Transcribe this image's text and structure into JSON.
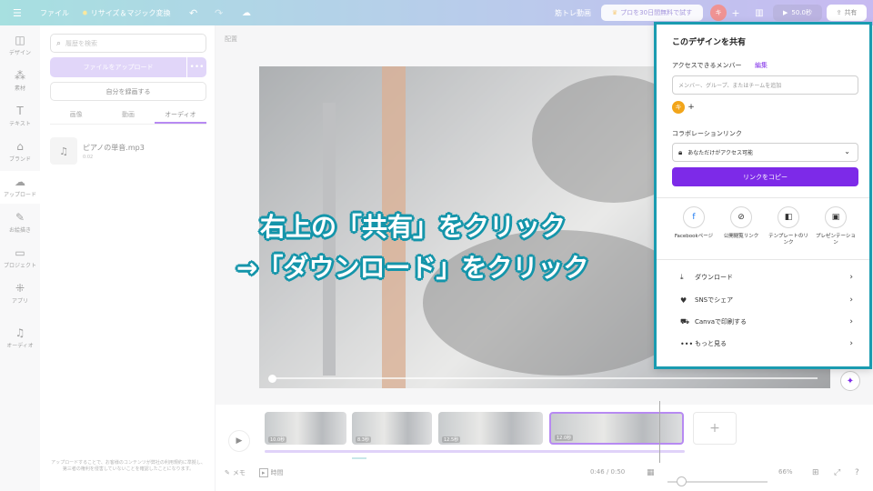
{
  "topbar": {
    "menu_icon": "hamburger-icon",
    "file_label": "ファイル",
    "resize_label": "リサイズ＆マジック変換",
    "title": "筋トレ動画",
    "pro_trial_label": "プロを30日間無料で試す",
    "avatar_initial": "キ",
    "add_label": "+",
    "duration_label": "50.0秒",
    "share_label": "共有"
  },
  "rail": {
    "items": [
      {
        "label": "デザイン",
        "icon": "◫"
      },
      {
        "label": "素材",
        "icon": "⁂"
      },
      {
        "label": "テキスト",
        "icon": "T"
      },
      {
        "label": "ブランド",
        "icon": "⌂"
      },
      {
        "label": "アップロード",
        "icon": "☁"
      },
      {
        "label": "お絵描き",
        "icon": "✎"
      },
      {
        "label": "プロジェクト",
        "icon": "▭"
      },
      {
        "label": "アプリ",
        "icon": "⁜"
      },
      {
        "label": "オーディオ",
        "icon": "♫"
      }
    ]
  },
  "panel": {
    "search_placeholder": "履歴を検索",
    "upload_label": "ファイルをアップロード",
    "more_label": "•••",
    "record_label": "自分を録画する",
    "tabs": [
      "画像",
      "動画",
      "オーディオ"
    ],
    "audio_item": {
      "name": "ピアノの単音.mp3",
      "duration": "0:02"
    },
    "note": "アップロードすることで、お客様のコンテンツが弊社の利用規約に準拠し、第三者の権利を侵害していないことを確認したことになります。"
  },
  "editor": {
    "label": "配置",
    "clips": [
      "10.0秒",
      "8.3秒",
      "12.5秒",
      "12.0秒"
    ],
    "add_clip": "+",
    "notes_label": "メモ",
    "time_label": "時間",
    "time_readout": "0:46 / 0:50",
    "zoom_readout": "66%"
  },
  "share_panel": {
    "title": "このデザインを共有",
    "access_label": "アクセスできるメンバー",
    "edit_link": "編集",
    "member_placeholder": "メンバー、グループ、またはチームを追加",
    "avatar_initial": "キ",
    "add_label": "+",
    "collab_label": "コラボレーションリンク",
    "access_value": "あなただけがアクセス可能",
    "copy_label": "リンクをコピー",
    "share_options": [
      {
        "label": "Facebookページ",
        "icon": "f"
      },
      {
        "label": "公開閲覧リンク",
        "icon": "⊘"
      },
      {
        "label": "テンプレートのリンク",
        "icon": "◧"
      },
      {
        "label": "プレゼンテーション",
        "icon": "▣"
      }
    ],
    "actions": [
      {
        "label": "ダウンロード",
        "icon": "⤓"
      },
      {
        "label": "SNSでシェア",
        "icon": "♥"
      },
      {
        "label": "Canvaで印刷する",
        "icon": "⛟"
      },
      {
        "label": "もっと見る",
        "icon": "•••"
      }
    ]
  },
  "annotation": {
    "line1": "右上の「共有」をクリック",
    "line2": "→「ダウンロード」をクリック"
  },
  "colors": {
    "accent": "#7d2ae8",
    "highlight_border": "#1a9bb0",
    "annotation_outline": "#1595aa"
  }
}
